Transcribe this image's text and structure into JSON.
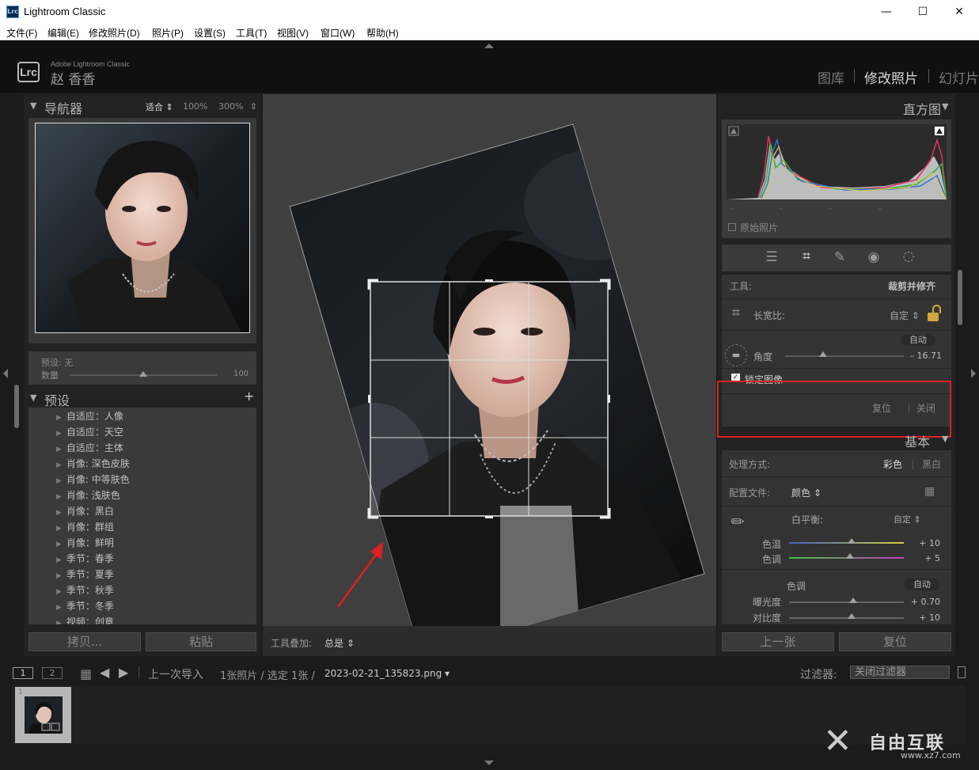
{
  "window": {
    "title": "Lightroom Classic",
    "app_icon": "Lrc",
    "minimize": "—",
    "maximize": "☐",
    "close": "✕"
  },
  "menu": [
    "文件(F)",
    "编辑(E)",
    "修改照片(D)",
    "照片(P)",
    "设置(S)",
    "工具(T)",
    "视图(V)",
    "窗口(W)",
    "帮助(H)"
  ],
  "identity": {
    "logo": "Lrc",
    "brand": "Adobe Lightroom Classic",
    "user": "赵 香香",
    "modules": [
      "图库",
      "修改照片",
      "幻灯片"
    ],
    "active_module": "修改照片"
  },
  "navigator": {
    "title": "导航器",
    "zoom_options": [
      "适合 ⇕",
      "100%",
      "300%",
      "⇕"
    ]
  },
  "preview_settings": {
    "preset_label": "预设: 无",
    "amount_label": "数量",
    "amount_value": "100"
  },
  "presets": {
    "title": "预设",
    "add": "+",
    "items": [
      "自适应：人像",
      "自适应：天空",
      "自适应：主体",
      "肖像: 深色皮肤",
      "肖像: 中等肤色",
      "肖像: 浅肤色",
      "肖像：黑白",
      "肖像：群组",
      "肖像：鲜明",
      "季节：春季",
      "季节：夏季",
      "季节：秋季",
      "季节：冬季",
      "视频：创意"
    ]
  },
  "left_buttons": {
    "copy": "拷贝...",
    "paste": "粘贴"
  },
  "toolbar": {
    "overlay_label": "工具叠加:",
    "overlay_value": "总是 ⇕"
  },
  "histogram": {
    "title": "直方图",
    "original_photo": "原始照片"
  },
  "crop": {
    "tool_label": "工具:",
    "tool_name": "裁剪并修齐",
    "aspect_label": "长宽比:",
    "aspect_value": "自定 ⇕",
    "auto": "自动",
    "angle_label": "角度",
    "angle_value": "– 16.71",
    "angle_fraction": 0.32,
    "lock_image": "锁定图像",
    "reset": "复位",
    "close": "关闭"
  },
  "basic": {
    "title": "基本",
    "treatment_label": "处理方式:",
    "color": "彩色",
    "bw": "黑白",
    "profile_label": "配置文件:",
    "profile_value": "颜色 ⇕",
    "wb_label": "白平衡:",
    "wb_value": "自定 ⇕",
    "temp_label": "色温",
    "temp_value": "+ 10",
    "tint_label": "色调",
    "tint_value": "+ 5",
    "tone_label": "色调",
    "tone_auto": "自动",
    "exposure_label": "曝光度",
    "exposure_value": "+ 0.70",
    "contrast_label": "对比度",
    "contrast_value": "+ 10"
  },
  "right_buttons": {
    "prev": "上一张",
    "reset": "复位"
  },
  "filmstrip": {
    "page1": "1",
    "page2": "2",
    "source": "上一次导入",
    "count": "1张照片 / 选定 1张 /",
    "filename": "2023-02-21_135823.png ▾",
    "filter_label": "过滤器:",
    "filter_value": "关闭过滤器",
    "thumb_index": "1"
  },
  "watermark": {
    "brand": "自由互联",
    "url": "www.xz7.com"
  },
  "colors": {
    "accent_red": "#e02020",
    "panel": "#2c2c2c",
    "bg": "#1b1b1b"
  }
}
